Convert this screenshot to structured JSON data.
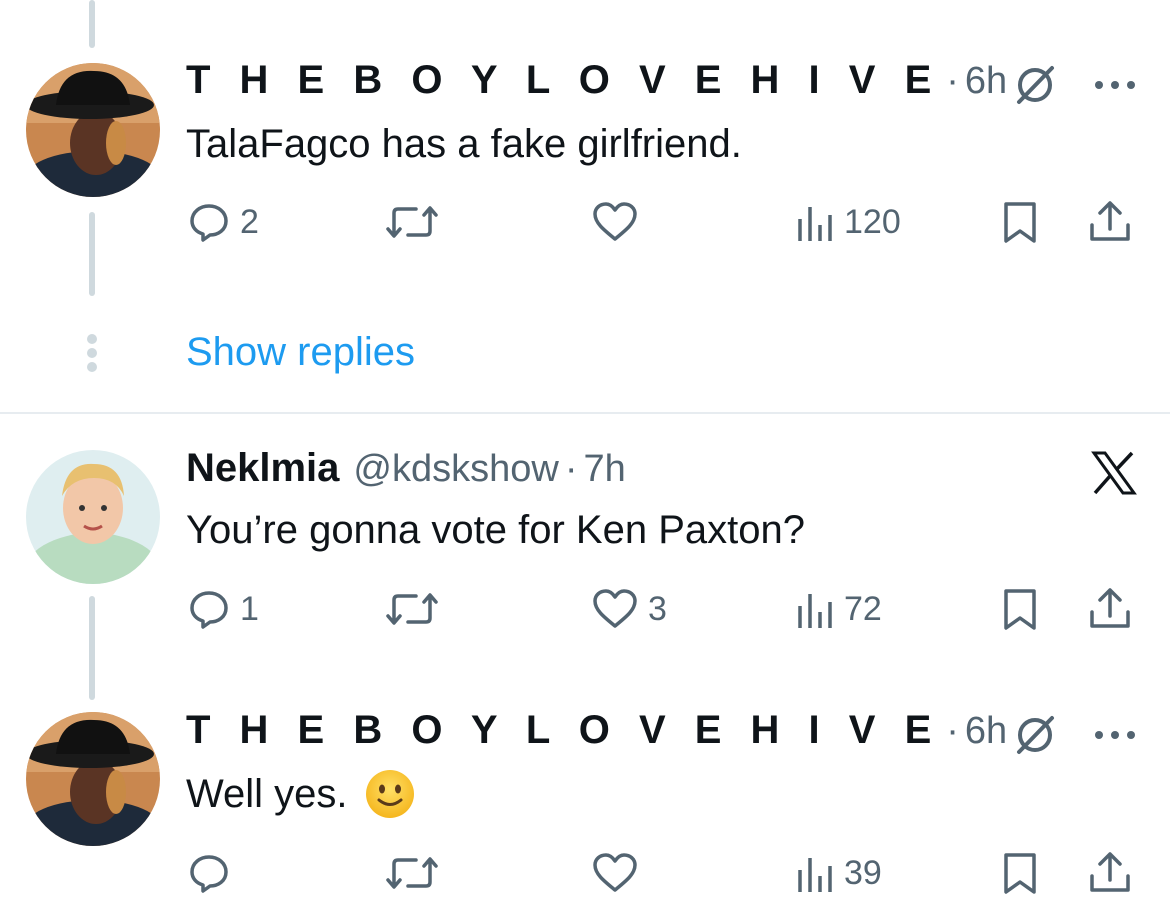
{
  "tweets": [
    {
      "name": "T H E B O Y L O V E H I V E",
      "handle": "",
      "time": "6h",
      "text": "TalaFagco has a fake girlfriend.",
      "replies": "2",
      "retweets": "",
      "likes": "",
      "views": "120",
      "badge_icon": "no-symbol-icon",
      "menu_icon": "more-icon"
    },
    {
      "name": "Neklmia",
      "handle": "@kdskshow",
      "time": "7h",
      "text": "You’re gonna vote for Ken Paxton?",
      "replies": "1",
      "retweets": "",
      "likes": "3",
      "views": "72",
      "badge_icon": "x-logo-icon"
    },
    {
      "name": "T H E B O Y L O V E H I V E",
      "handle": "",
      "time": "6h",
      "text": "Well yes.",
      "emoji": "slightly-smiling-face",
      "replies": "",
      "retweets": "",
      "likes": "",
      "views": "39",
      "badge_icon": "no-symbol-icon",
      "menu_icon": "more-icon"
    }
  ],
  "show_replies_label": "Show replies",
  "separator": "·",
  "colors": {
    "link": "#1d9bf0",
    "secondary": "#536471",
    "thread_line": "#cfd9de",
    "primary_text": "#0f1419"
  }
}
